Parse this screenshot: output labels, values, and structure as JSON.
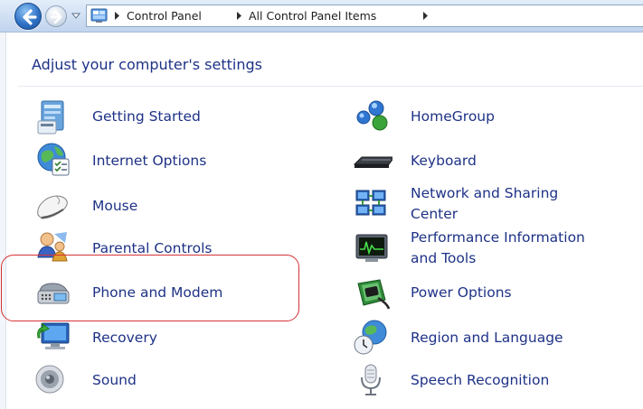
{
  "address_bar": {
    "breadcrumbs": [
      "Control Panel",
      "All Control Panel Items"
    ],
    "icons": [
      "back-arrow-icon",
      "forward-arrow-icon",
      "recent-pages-dropdown-icon",
      "control-panel-icon",
      "breadcrumb-separator-icon"
    ]
  },
  "main": {
    "heading": "Adjust your computer's settings",
    "items_left": [
      {
        "label": "Getting Started",
        "icon": "getting-started-icon"
      },
      {
        "label": "Internet Options",
        "icon": "internet-options-icon"
      },
      {
        "label": "Mouse",
        "icon": "mouse-icon"
      },
      {
        "label": "Parental Controls",
        "icon": "parental-controls-icon"
      },
      {
        "label": "Phone and Modem",
        "icon": "phone-and-modem-icon"
      },
      {
        "label": "Recovery",
        "icon": "recovery-icon"
      },
      {
        "label": "Sound",
        "icon": "sound-icon"
      }
    ],
    "items_right": [
      {
        "label": "HomeGroup",
        "icon": "homegroup-icon"
      },
      {
        "label": "Keyboard",
        "icon": "keyboard-icon"
      },
      {
        "label_lines": [
          "Network and Sharing",
          "Center"
        ],
        "icon": "network-sharing-icon"
      },
      {
        "label_lines": [
          "Performance Information",
          "and Tools"
        ],
        "icon": "performance-icon"
      },
      {
        "label": "Power Options",
        "icon": "power-options-icon"
      },
      {
        "label": "Region and Language",
        "icon": "region-language-icon"
      },
      {
        "label": "Speech Recognition",
        "icon": "speech-recognition-icon"
      }
    ]
  },
  "annotation": {
    "highlight_color": "#d73236",
    "highlighted_item": "Phone and Modem"
  },
  "colors": {
    "link_text": "#1e3287",
    "addressbar_top": "#e4eefb",
    "addressbar_bottom": "#c1d4ee"
  }
}
